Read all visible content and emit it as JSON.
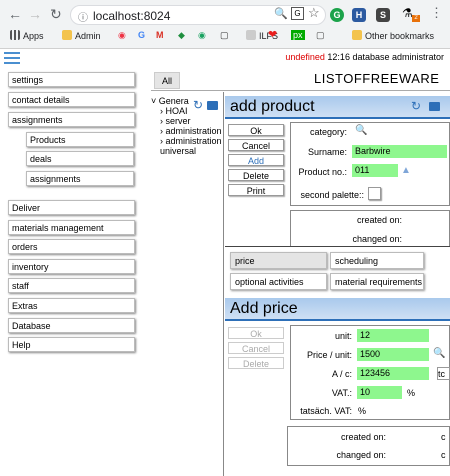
{
  "browser": {
    "url": "localhost:8024",
    "bookmarks": [
      "Apps",
      "Admin",
      "G",
      "M",
      "ILFS",
      "px"
    ],
    "other_bookmarks": "Other bookmarks",
    "ext_badge": "2"
  },
  "app": {
    "status_undefined": "undefined",
    "status_text": "12:16 database administrator",
    "list_title": "LISTOFFREEWARE",
    "all_tab": "All"
  },
  "nav": {
    "top": [
      "settings",
      "contact details",
      "assignments"
    ],
    "sub": [
      "Products",
      "deals",
      "assignments"
    ],
    "bottom": [
      "Deliver",
      "materials management",
      "orders",
      "inventory",
      "staff",
      "Extras",
      "Database",
      "Help"
    ]
  },
  "tree": [
    "Genera",
    "HOAI",
    "server",
    "administration",
    "administration",
    "universal"
  ],
  "product": {
    "title": "add product",
    "buttons": [
      "Ok",
      "Cancel",
      "Add",
      "Delete",
      "Print"
    ],
    "category_label": "category:",
    "surname_label": "Surname:",
    "surname_value": "Barbwire",
    "productno_label": "Product no.:",
    "productno_value": "011",
    "palette_label": "second palette::",
    "created_label": "created on:",
    "changed_label": "changed on:"
  },
  "tabs": [
    "price",
    "scheduling",
    "optional activities",
    "material requirements"
  ],
  "price": {
    "title": "Add price",
    "buttons": [
      "Ok",
      "Cancel",
      "Delete"
    ],
    "unit_label": "unit:",
    "unit_value": "12",
    "price_label": "Price / unit:",
    "price_value": "1500",
    "ac_label": "A / c:",
    "ac_value": "123456",
    "ac_btn": "tc",
    "vat_label": "VAT.:",
    "vat_value": "10",
    "vat_unit": "%",
    "tvat_label": "tatsäch. VAT:",
    "tvat_unit": "%",
    "created_label": "created on:",
    "created_value": "c",
    "changed_label": "changed on:",
    "changed_value": "c"
  }
}
